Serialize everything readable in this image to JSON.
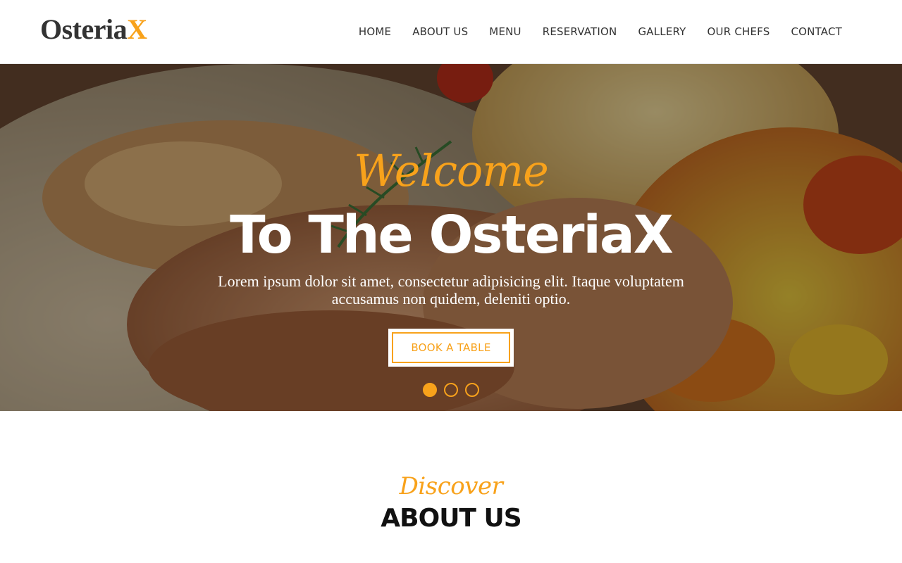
{
  "header": {
    "logo": {
      "main": "Osteria",
      "accent": "X"
    },
    "nav": [
      "HOME",
      "ABOUT US",
      "MENU",
      "RESERVATION",
      "GALLERY",
      "OUR CHEFS",
      "CONTACT"
    ]
  },
  "hero": {
    "welcome": "Welcome",
    "title": "To The OsteriaX",
    "text": "Lorem ipsum dolor sit amet, consectetur adipisicing elit. Itaque voluptatem accusamus non quidem, deleniti optio.",
    "button_label": "BOOK A TABLE",
    "slides": 3,
    "active_slide": 1
  },
  "about": {
    "kicker": "Discover",
    "title": "ABOUT US"
  },
  "colors": {
    "accent": "#f8a21b",
    "text_dark": "#333333"
  }
}
